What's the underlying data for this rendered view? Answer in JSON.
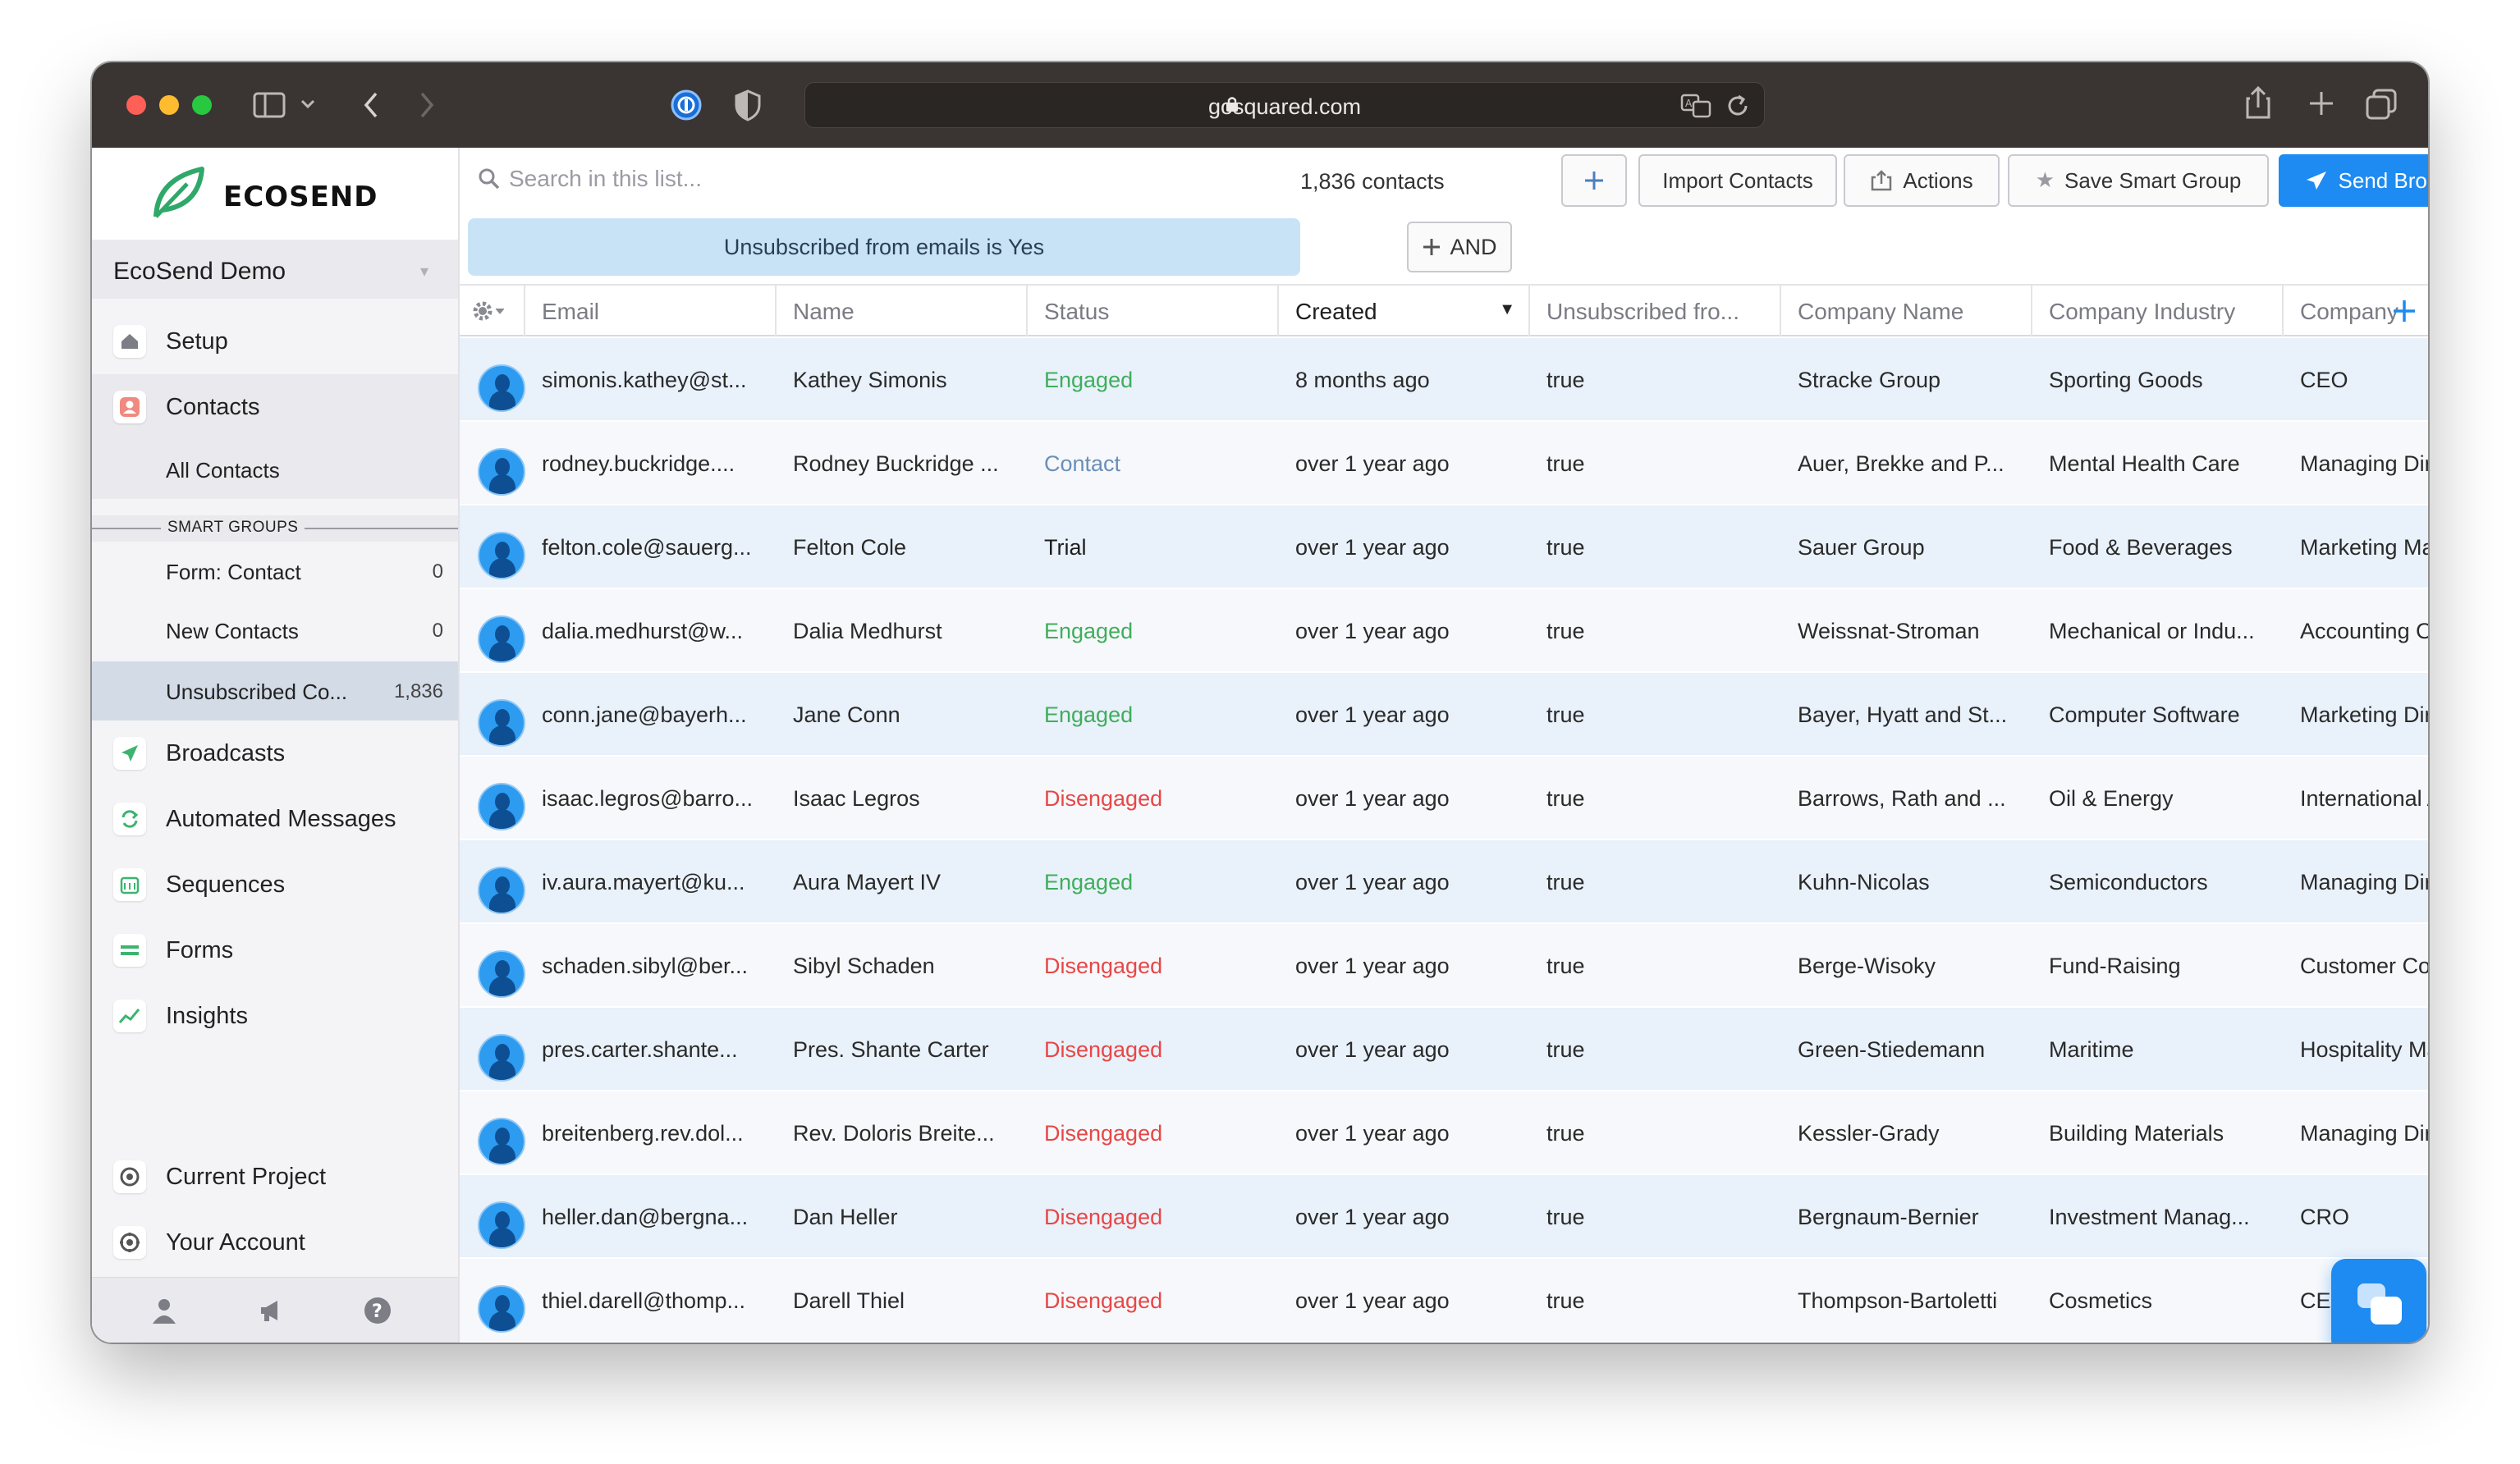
{
  "browser": {
    "url": "gosquared.com"
  },
  "sidebar": {
    "brand": "ECOSEND",
    "project": "EcoSend Demo",
    "items": [
      {
        "label": "Setup",
        "icon": "home-icon"
      },
      {
        "label": "Contacts",
        "icon": "contacts-icon"
      },
      {
        "label": "Broadcasts",
        "icon": "send-icon"
      },
      {
        "label": "Automated Messages",
        "icon": "automation-icon"
      },
      {
        "label": "Sequences",
        "icon": "sequence-icon"
      },
      {
        "label": "Forms",
        "icon": "form-icon"
      },
      {
        "label": "Insights",
        "icon": "chart-icon"
      },
      {
        "label": "Current Project",
        "icon": "project-icon"
      },
      {
        "label": "Your Account",
        "icon": "account-icon"
      }
    ],
    "all_contacts": "All Contacts",
    "smart_groups_header": "SMART GROUPS",
    "smart_groups": [
      {
        "label": "Form: Contact",
        "count": "0"
      },
      {
        "label": "New Contacts",
        "count": "0"
      },
      {
        "label": "Unsubscribed Co...",
        "count": "1,836"
      }
    ]
  },
  "toolbar": {
    "search_placeholder": "Search in this list...",
    "contacts_count": "1,836 contacts",
    "add_label": "+",
    "import_label": "Import Contacts",
    "actions_label": "Actions",
    "save_smart_group_label": "Save Smart Group",
    "send_broadcast_label": "Send Broadcast"
  },
  "filter": {
    "chip": "Unsubscribed from emails is Yes",
    "and_label": "AND"
  },
  "table": {
    "columns": [
      "Email",
      "Name",
      "Status",
      "Created",
      "Unsubscribed fro...",
      "Company Name",
      "Company Industry",
      "Company"
    ],
    "rows": [
      {
        "email": "simonis.kathey@st...",
        "name": "Kathey Simonis",
        "status": "Engaged",
        "status_kind": "engaged",
        "created": "8 months ago",
        "unsub": "true",
        "company": "Stracke Group",
        "industry": "Sporting Goods",
        "title": "CEO"
      },
      {
        "email": "rodney.buckridge....",
        "name": "Rodney Buckridge ...",
        "status": "Contact",
        "status_kind": "contact",
        "created": "over 1 year ago",
        "unsub": "true",
        "company": "Auer, Brekke and P...",
        "industry": "Mental Health Care",
        "title": "Managing Directo"
      },
      {
        "email": "felton.cole@sauerg...",
        "name": "Felton Cole",
        "status": "Trial",
        "status_kind": "trial",
        "created": "over 1 year ago",
        "unsub": "true",
        "company": "Sauer Group",
        "industry": "Food & Beverages",
        "title": "Marketing Manag"
      },
      {
        "email": "dalia.medhurst@w...",
        "name": "Dalia Medhurst",
        "status": "Engaged",
        "status_kind": "engaged",
        "created": "over 1 year ago",
        "unsub": "true",
        "company": "Weissnat-Stroman",
        "industry": "Mechanical or Indu...",
        "title": "Accounting Officer"
      },
      {
        "email": "conn.jane@bayerh...",
        "name": "Jane Conn",
        "status": "Engaged",
        "status_kind": "engaged",
        "created": "over 1 year ago",
        "unsub": "true",
        "company": "Bayer, Hyatt and St...",
        "industry": "Computer Software",
        "title": "Marketing Directo"
      },
      {
        "email": "isaac.legros@barro...",
        "name": "Isaac Legros",
        "status": "Disengaged",
        "status_kind": "disengaged",
        "created": "over 1 year ago",
        "unsub": "true",
        "company": "Barrows, Rath and ...",
        "industry": "Oil & Energy",
        "title": "International Adm"
      },
      {
        "email": "iv.aura.mayert@ku...",
        "name": "Aura Mayert IV",
        "status": "Engaged",
        "status_kind": "engaged",
        "created": "over 1 year ago",
        "unsub": "true",
        "company": "Kuhn-Nicolas",
        "industry": "Semiconductors",
        "title": "Managing Directo"
      },
      {
        "email": "schaden.sibyl@ber...",
        "name": "Sibyl Schaden",
        "status": "Disengaged",
        "status_kind": "disengaged",
        "created": "over 1 year ago",
        "unsub": "true",
        "company": "Berge-Wisoky",
        "industry": "Fund-Raising",
        "title": "Customer Consult"
      },
      {
        "email": "pres.carter.shante...",
        "name": "Pres. Shante Carter",
        "status": "Disengaged",
        "status_kind": "disengaged",
        "created": "over 1 year ago",
        "unsub": "true",
        "company": "Green-Stiedemann",
        "industry": "Maritime",
        "title": "Hospitality Manag"
      },
      {
        "email": "breitenberg.rev.dol...",
        "name": "Rev. Doloris Breite...",
        "status": "Disengaged",
        "status_kind": "disengaged",
        "created": "over 1 year ago",
        "unsub": "true",
        "company": "Kessler-Grady",
        "industry": "Building Materials",
        "title": "Managing Directo"
      },
      {
        "email": "heller.dan@bergna...",
        "name": "Dan Heller",
        "status": "Disengaged",
        "status_kind": "disengaged",
        "created": "over 1 year ago",
        "unsub": "true",
        "company": "Bergnaum-Bernier",
        "industry": "Investment Manag...",
        "title": "CRO"
      },
      {
        "email": "thiel.darell@thomp...",
        "name": "Darell Thiel",
        "status": "Disengaged",
        "status_kind": "disengaged",
        "created": "over 1 year ago",
        "unsub": "true",
        "company": "Thompson-Bartoletti",
        "industry": "Cosmetics",
        "title": "CEO"
      }
    ]
  },
  "colors": {
    "accent": "#1d8bf1",
    "engaged": "#3fae5c",
    "disengaged": "#e84646",
    "filter_chip": "#c8e3f6"
  }
}
